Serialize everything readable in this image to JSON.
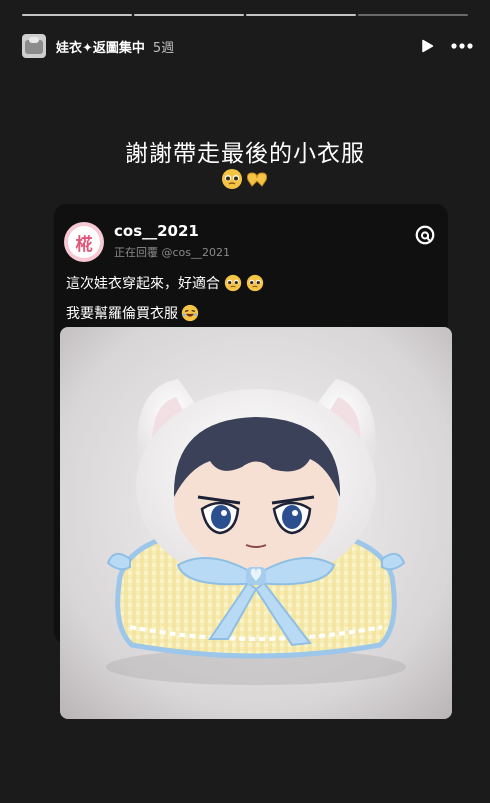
{
  "story": {
    "account_name": "娃衣✦返圖集中",
    "time_ago": "5週",
    "caption": "謝謝帶走最後的小衣服",
    "caption_emojis": [
      "pleading-face",
      "heart-hands"
    ]
  },
  "post": {
    "avatar_char": "椛",
    "username": "cos__2021",
    "reply_context": "正在回覆 @cos__2021",
    "line1": "這次娃衣穿起來，好適合",
    "line1_emojis": [
      "pleading-face",
      "pleading-face"
    ],
    "line2": "我要幫羅倫買衣服",
    "line2_emojis": [
      "rolling-laughing-face"
    ],
    "platform_icon": "threads-icon",
    "photo_subject": "plush-doll-in-white-cat-hood-and-yellow-gingham-cape"
  },
  "colors": {
    "background": "#1b1b1b",
    "card": "#101010",
    "text": "#ffffff",
    "muted": "#8a8a8a"
  }
}
